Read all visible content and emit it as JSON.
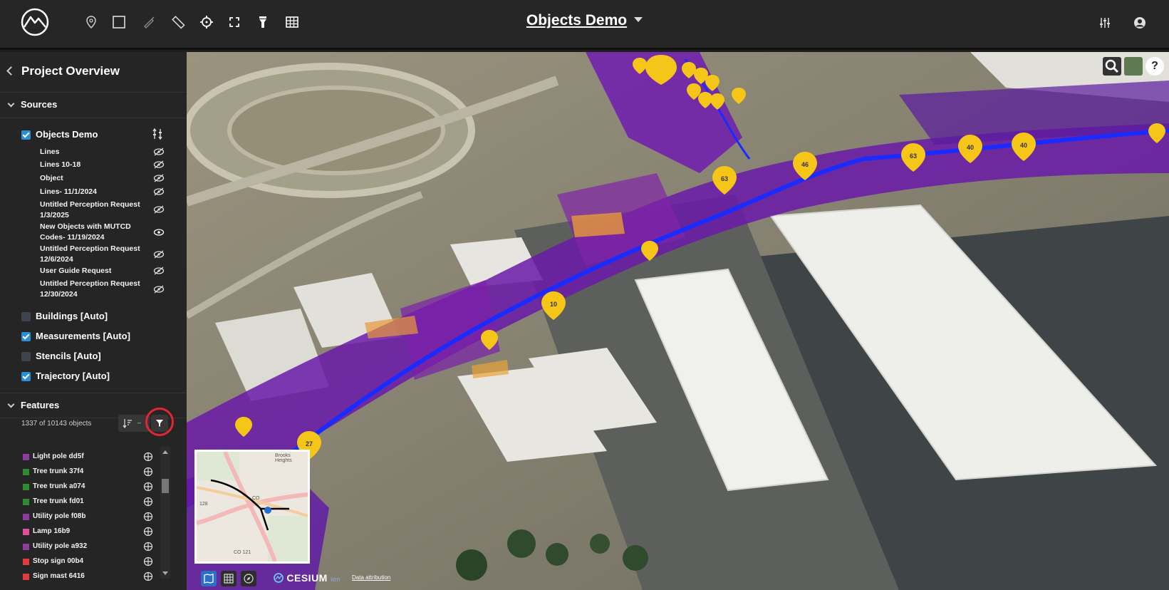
{
  "header": {
    "title": "Objects Demo"
  },
  "toolbar": {
    "tools": [
      "map-pin-icon",
      "rectangle-icon",
      "brush-icon",
      "ruler-icon",
      "crosshair-icon",
      "fit-bounds-icon",
      "flashlight-icon",
      "grid-icon"
    ],
    "right_tools": [
      "sliders-icon",
      "user-icon"
    ]
  },
  "sidebar": {
    "title": "Project Overview",
    "sources_header": "Sources",
    "sources": [
      {
        "label": "Objects Demo",
        "checked": true
      },
      {
        "label": "Buildings [Auto]",
        "checked": false
      },
      {
        "label": "Measurements [Auto]",
        "checked": true
      },
      {
        "label": "Stencils [Auto]",
        "checked": false
      },
      {
        "label": "Trajectory [Auto]",
        "checked": true
      }
    ],
    "layers": [
      {
        "label": "Lines",
        "visible": false
      },
      {
        "label": "Lines 10-18",
        "visible": false
      },
      {
        "label": "Object",
        "visible": false
      },
      {
        "label": "Lines- 11/1/2024",
        "visible": false
      },
      {
        "label": "Untitled Perception Request 1/3/2025",
        "visible": false
      },
      {
        "label": "New Objects with MUTCD Codes- 11/19/2024",
        "visible": true
      },
      {
        "label": "Untitled Perception Request 12/6/2024",
        "visible": false
      },
      {
        "label": "User Guide Request",
        "visible": false
      },
      {
        "label": "Untitled Perception Request 12/30/2024",
        "visible": false
      }
    ],
    "features_header": "Features",
    "feature_count": "1337 of 10143 objects",
    "features": [
      {
        "label": "Light pole dd5f",
        "color": "#8e3b9e"
      },
      {
        "label": "Tree trunk 37f4",
        "color": "#2e8b2e"
      },
      {
        "label": "Tree trunk a074",
        "color": "#2e8b2e"
      },
      {
        "label": "Tree trunk fd01",
        "color": "#2e8b2e"
      },
      {
        "label": "Utility pole f08b",
        "color": "#8e3b9e"
      },
      {
        "label": "Lamp 16b9",
        "color": "#e0509a"
      },
      {
        "label": "Utility pole a932",
        "color": "#8e3b9e"
      },
      {
        "label": "Stop sign 00b4",
        "color": "#e03c3c"
      },
      {
        "label": "Sign mast 6416",
        "color": "#e03c3c"
      }
    ]
  },
  "map": {
    "pins": [
      "63",
      "46",
      "63",
      "40",
      "40",
      "10",
      "27"
    ],
    "minimap_labels": [
      "Brooks Heights",
      "CO",
      "128",
      "CO 121"
    ],
    "brand": "CESIUM",
    "brand_suffix": "ion",
    "attribution": "Data attribution",
    "controls": [
      "search-icon",
      "layers-icon",
      "help-icon"
    ]
  },
  "colors": {
    "accent": "#2b8fd8",
    "highlight": "#e3262c",
    "trajectory": "#1a2bff",
    "pin": "#f5c518"
  }
}
